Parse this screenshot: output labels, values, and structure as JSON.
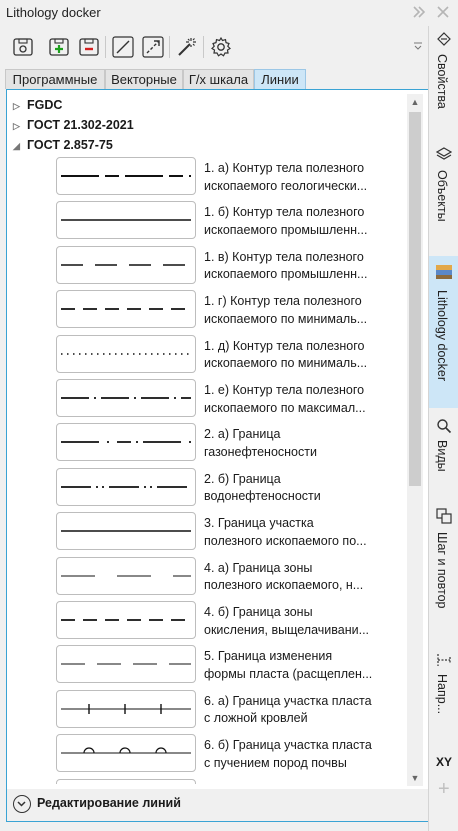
{
  "window": {
    "title": "Lithology docker",
    "menu_icon": "double-chevron-right-icon",
    "close_icon": "close-icon"
  },
  "toolbar": {
    "buttons": [
      "new-library-icon",
      "add-icon",
      "remove-icon",
      "line-icon",
      "arrow-line-icon",
      "magic-wand-icon",
      "settings-gear-icon"
    ]
  },
  "tabs": [
    {
      "label": "Программные"
    },
    {
      "label": "Векторные"
    },
    {
      "label": "Г/х шкала"
    },
    {
      "label": "Линии",
      "active": true
    }
  ],
  "tree": {
    "nodes": [
      {
        "label": "FGDC",
        "expanded": false
      },
      {
        "label": "ГОСТ 21.302-2021",
        "expanded": false
      },
      {
        "label": "ГОСТ 2.857-75",
        "expanded": true
      }
    ],
    "items": [
      {
        "line1": "1. а) Контур тела полезного",
        "line2": "ископаемого геологически...",
        "style": "dash-long-short"
      },
      {
        "line1": "1. б) Контур тела полезного",
        "line2": "ископаемого промышленн...",
        "style": "solid"
      },
      {
        "line1": "1. в) Контур тела полезного",
        "line2": "ископаемого промышленн...",
        "style": "dash-long"
      },
      {
        "line1": "1. г) Контур тела полезного",
        "line2": "ископаемого по минималь...",
        "style": "dash-medium"
      },
      {
        "line1": "1. д) Контур тела полезного",
        "line2": "ископаемого по минималь...",
        "style": "dotted"
      },
      {
        "line1": "1. е) Контур тела полезного",
        "line2": "ископаемого по максимал...",
        "style": "dash-dot"
      },
      {
        "line1": "2. а) Граница",
        "line2": "газонефтеносности",
        "style": "long-dot-short"
      },
      {
        "line1": "2. б) Граница",
        "line2": "водонефтеносности",
        "style": "dash-dot-dot"
      },
      {
        "line1": "3. Граница участка",
        "line2": "полезного ископаемого по...",
        "style": "solid"
      },
      {
        "line1": "4. а) Граница зоны",
        "line2": "полезного ископаемого, н...",
        "style": "thin-gaps"
      },
      {
        "line1": "4. б) Граница зоны",
        "line2": "окисления, выщелачивани...",
        "style": "dash-medium"
      },
      {
        "line1": "5. Граница изменения",
        "line2": "формы пласта (расщеплен...",
        "style": "thin-dash"
      },
      {
        "line1": "6. а) Граница участка пласта",
        "line2": "с ложной кровлей",
        "style": "tick-marks"
      },
      {
        "line1": "6. б) Граница участка пласта",
        "line2": "с пучением пород почвы",
        "style": "arc-marks"
      }
    ]
  },
  "footer": {
    "label": "Редактирование линий",
    "icon": "chevron-down-circle-icon"
  },
  "right_rail": [
    {
      "label": "Свойства",
      "icon": "properties-icon"
    },
    {
      "label": "Объекты",
      "icon": "layers-icon"
    },
    {
      "label": "Lithology docker",
      "icon": "lithology-icon",
      "active": true
    },
    {
      "label": "Виды",
      "icon": "search-icon"
    },
    {
      "label": "Шаг и повтор",
      "icon": "step-repeat-icon"
    },
    {
      "label": "Напр...",
      "icon": "dimension-icon"
    },
    {
      "label": "XY",
      "icon": "xy-icon"
    },
    {
      "label": "+",
      "icon": "add-tab-icon"
    }
  ]
}
